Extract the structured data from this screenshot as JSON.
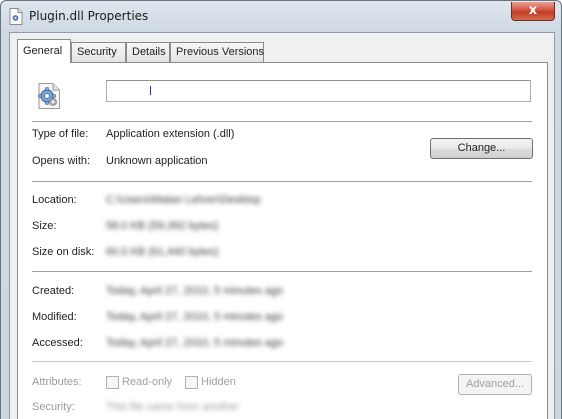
{
  "window": {
    "title": "Plugin.dll Properties",
    "close_label": "x"
  },
  "tabs": [
    {
      "label": "General",
      "active": true
    },
    {
      "label": "Security",
      "active": false
    },
    {
      "label": "Details",
      "active": false
    },
    {
      "label": "Previous Versions",
      "active": false
    }
  ],
  "general": {
    "file_name_value": "",
    "type_of_file": {
      "label": "Type of file:",
      "value": "Application extension (.dll)"
    },
    "opens_with": {
      "label": "Opens with:",
      "value": "Unknown application"
    },
    "change_button": "Change...",
    "location": {
      "label": "Location:",
      "value": "C:\\Users\\Matan Lehrer\\Desktop"
    },
    "size": {
      "label": "Size:",
      "value": "58.0 KB (59,392 bytes)"
    },
    "size_on_disk": {
      "label": "Size on disk:",
      "value": "60.0 KB (61,440 bytes)"
    },
    "created": {
      "label": "Created:",
      "value": "Today, April 27, 2010, 5 minutes ago"
    },
    "modified": {
      "label": "Modified:",
      "value": "Today, April 27, 2010, 5 minutes ago"
    },
    "accessed": {
      "label": "Accessed:",
      "value": "Today, April 27, 2010, 5 minutes ago"
    },
    "attributes": {
      "label": "Attributes:",
      "readonly": "Read-only",
      "hidden": "Hidden",
      "advanced_button": "Advanced..."
    },
    "security": {
      "label": "Security:",
      "value": "This file came from another"
    }
  },
  "colors": {
    "close_button": "#c13a22",
    "panel_background": "#ffffff",
    "caret": "#2a2ad0"
  },
  "icons": {
    "title": "dll-file-icon",
    "file": "dll-gear-file-icon"
  }
}
